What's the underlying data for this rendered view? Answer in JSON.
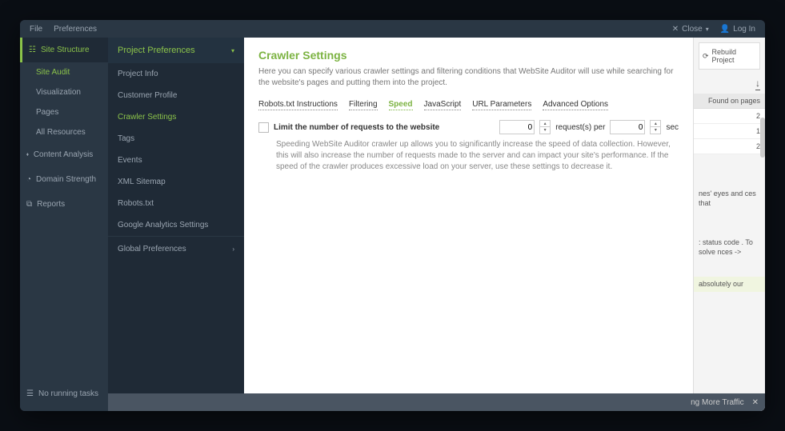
{
  "menubar": {
    "file": "File",
    "prefs": "Preferences",
    "close": "Close",
    "login": "Log In"
  },
  "nav1": {
    "site_structure": "Site Structure",
    "site_audit": "Site Audit",
    "visualization": "Visualization",
    "pages": "Pages",
    "all_resources": "All Resources",
    "content_analysis": "Content Analysis",
    "domain_strength": "Domain Strength",
    "reports": "Reports",
    "no_tasks": "No running tasks"
  },
  "nav2": {
    "header": "Project Preferences",
    "project_info": "Project Info",
    "customer_profile": "Customer Profile",
    "crawler_settings": "Crawler Settings",
    "tags": "Tags",
    "events": "Events",
    "xml_sitemap": "XML Sitemap",
    "robots": "Robots.txt",
    "ga": "Google Analytics Settings",
    "global": "Global Preferences"
  },
  "modal": {
    "title": "Crawler Settings",
    "desc": "Here you can specify various crawler settings and filtering conditions that WebSite Auditor will use while searching for the website's pages and putting them into the project.",
    "tabs": {
      "robots": "Robots.txt Instructions",
      "filtering": "Filtering",
      "speed": "Speed",
      "javascript": "JavaScript",
      "url": "URL Parameters",
      "advanced": "Advanced Options"
    },
    "setting_label": "Limit the number of requests to the website",
    "req_val": "0",
    "req_unit": "request(s) per",
    "sec_val": "0",
    "sec_unit": "sec",
    "setting_desc": "Speeding WebSite Auditor crawler up allows you to significantly increase the speed of data collection. However, this will also increase the number of requests made to the server and can impact your site's performance. If the speed of the crawler produces excessive load on your server, use these settings to decrease it."
  },
  "right": {
    "rebuild": "Rebuild Project",
    "col": "Found on pages",
    "rows": [
      "2",
      "1",
      "2"
    ],
    "text1": "nes' eyes and ces that",
    "text2": ": status code . To solve nces ->",
    "text3": "absolutely our",
    "footer": "ng More Traffic"
  }
}
